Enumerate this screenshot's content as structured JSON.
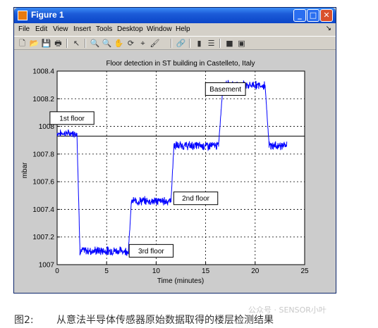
{
  "window": {
    "title": "Figure 1",
    "minimize_glyph": "_",
    "maximize_glyph": "□",
    "close_glyph": "✕"
  },
  "menu": [
    "File",
    "Edit",
    "View",
    "Insert",
    "Tools",
    "Desktop",
    "Window",
    "Help"
  ],
  "menu_overflow": "↘",
  "toolbar_icons": [
    {
      "name": "new-figure-icon",
      "glyph": "🗋"
    },
    {
      "name": "open-file-icon",
      "glyph": "📂"
    },
    {
      "name": "save-icon",
      "glyph": "💾"
    },
    {
      "name": "print-icon",
      "glyph": "🖶"
    },
    {
      "name": "edit-plot-icon",
      "glyph": "↖"
    },
    {
      "name": "zoom-in-icon",
      "glyph": "🔍"
    },
    {
      "name": "zoom-out-icon",
      "glyph": "🔍"
    },
    {
      "name": "pan-icon",
      "glyph": "✋"
    },
    {
      "name": "rotate-3d-icon",
      "glyph": "⟳"
    },
    {
      "name": "data-cursor-icon",
      "glyph": "⌖"
    },
    {
      "name": "brush-icon",
      "glyph": "🖌"
    },
    {
      "name": "link-plot-icon",
      "glyph": "🔗"
    },
    {
      "name": "insert-colorbar-icon",
      "glyph": "▮"
    },
    {
      "name": "insert-legend-icon",
      "glyph": "☰"
    },
    {
      "name": "hide-plot-tools-icon",
      "glyph": "■"
    },
    {
      "name": "show-plot-tools-icon",
      "glyph": "▣"
    }
  ],
  "caption": {
    "number": "图2:",
    "text": "从意法半导体传感器原始数据取得的楼层检测结果"
  },
  "watermark": "公众号 · SENSOR小叶",
  "chart_data": {
    "type": "line",
    "title": "Floor detection in ST building in Castelleto, Italy",
    "xlabel": "Time (minutes)",
    "ylabel": "mbar",
    "xlim": [
      0,
      25
    ],
    "ylim": [
      1007,
      1008.4
    ],
    "xticks": [
      0,
      5,
      10,
      15,
      20,
      25
    ],
    "yticks": [
      1007,
      1007.2,
      1007.4,
      1007.6,
      1007.8,
      1008,
      1008.2,
      1008.4
    ],
    "ytick_labels": [
      "1007",
      "1007.2",
      "1007.4",
      "1007.6",
      "1007.8",
      "1008",
      "1008.2",
      "1008.4"
    ],
    "grid": true,
    "reference_line": 1007.93,
    "line_color": "#0000ff",
    "segments": [
      {
        "x0": 0,
        "x1": 2.0,
        "level": 1007.95,
        "noise": 0.02
      },
      {
        "x0": 2.0,
        "x1": 2.3,
        "level_start": 1007.95,
        "level_end": 1007.12,
        "transition": true
      },
      {
        "x0": 2.3,
        "x1": 7.2,
        "level": 1007.1,
        "noise": 0.025
      },
      {
        "x0": 7.2,
        "x1": 7.5,
        "level_start": 1007.1,
        "level_end": 1007.45,
        "transition": true
      },
      {
        "x0": 7.5,
        "x1": 11.5,
        "level": 1007.46,
        "noise": 0.025
      },
      {
        "x0": 11.5,
        "x1": 11.8,
        "level_start": 1007.46,
        "level_end": 1007.87,
        "transition": true
      },
      {
        "x0": 11.8,
        "x1": 16.3,
        "level": 1007.86,
        "noise": 0.025
      },
      {
        "x0": 16.3,
        "x1": 16.7,
        "level_start": 1007.86,
        "level_end": 1008.25,
        "transition": true
      },
      {
        "x0": 16.7,
        "x1": 21.0,
        "level": 1008.3,
        "noise": 0.025
      },
      {
        "x0": 21.0,
        "x1": 21.4,
        "level_start": 1008.3,
        "level_end": 1007.87,
        "transition": true
      },
      {
        "x0": 21.4,
        "x1": 23.2,
        "level": 1007.86,
        "noise": 0.025
      }
    ],
    "annotations": [
      {
        "text": "1st floor",
        "x": 1.5,
        "y": 1008.06
      },
      {
        "text": "Basement",
        "x": 17.0,
        "y": 1008.27
      },
      {
        "text": "2nd floor",
        "x": 14.0,
        "y": 1007.48
      },
      {
        "text": "3rd floor",
        "x": 9.5,
        "y": 1007.1
      }
    ]
  }
}
